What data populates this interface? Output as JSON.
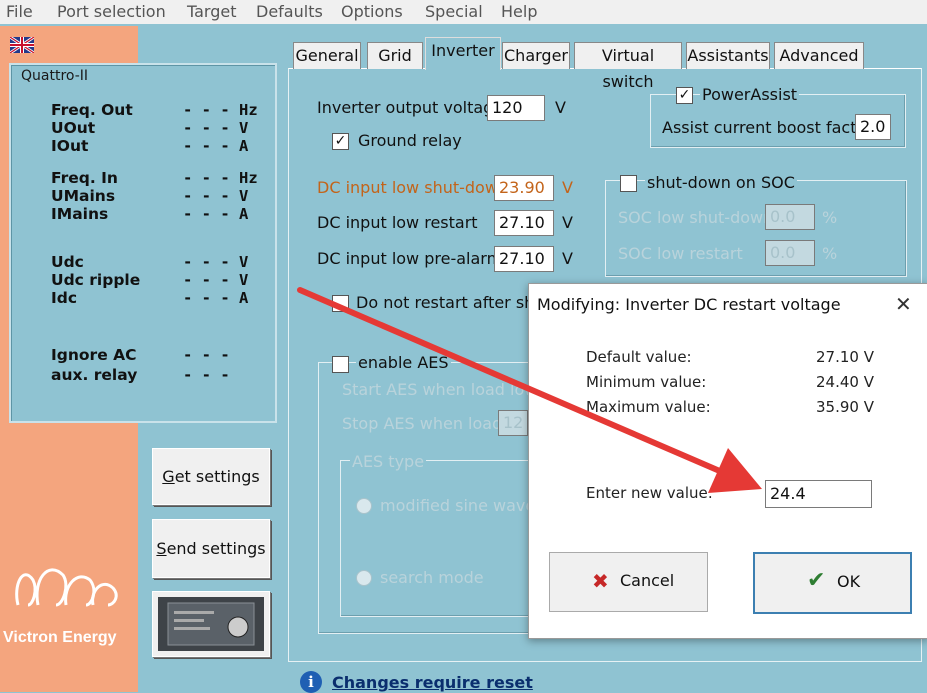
{
  "menubar": {
    "items": [
      "File",
      "Port selection",
      "Target",
      "Defaults",
      "Options",
      "Special",
      "Help"
    ]
  },
  "status": {
    "title": "Quattro-II",
    "rows": [
      {
        "label": "Freq. Out",
        "value": "- - - Hz"
      },
      {
        "label": "UOut",
        "value": "- - - V"
      },
      {
        "label": "IOut",
        "value": "- - - A"
      },
      {
        "label": "Freq. In",
        "value": "- - - Hz"
      },
      {
        "label": "UMains",
        "value": "- - - V"
      },
      {
        "label": "IMains",
        "value": "- - - A"
      },
      {
        "label": "Udc",
        "value": "- - - V"
      },
      {
        "label": "Udc ripple",
        "value": "- - - V"
      },
      {
        "label": "Idc",
        "value": "- - - A"
      },
      {
        "label": "Ignore AC",
        "value": "- - -"
      },
      {
        "label": "aux. relay",
        "value": "- - -"
      }
    ]
  },
  "left_buttons": {
    "get_settings_ul": "G",
    "get_settings_rest": "et settings",
    "send_settings_ul": "S",
    "send_settings_rest": "end settings"
  },
  "logo_text": "Victron Energy",
  "tabs": [
    "General",
    "Grid",
    "Inverter",
    "Charger",
    "Virtual switch",
    "Assistants",
    "Advanced"
  ],
  "active_tab": "Inverter",
  "inverter": {
    "output_voltage_label": "Inverter output voltage",
    "output_voltage_value": "120",
    "output_voltage_unit": "V",
    "ground_relay_label": "Ground relay",
    "ground_relay_checked": "✓",
    "shutdown_label": "DC input low shut-down",
    "shutdown_value": "23.90",
    "shutdown_unit": "V",
    "restart_label": "DC input low restart",
    "restart_value": "27.10",
    "restart_unit": "V",
    "prealarm_label": "DC input low pre-alarm",
    "prealarm_value": "27.10",
    "prealarm_unit": "V",
    "no_restart_label": "Do not restart after short",
    "power_assist_label": "PowerAssist",
    "power_assist_checked": "✓",
    "boost_label": "Assist current boost factor",
    "boost_value": "2.0",
    "soc_label": "shut-down on SOC",
    "soc_shutdown_label": "SOC low shut-down",
    "soc_shutdown_value": "0.0",
    "soc_restart_label": "SOC low restart",
    "soc_restart_value": "0.0",
    "percent": "%",
    "aes_label": "enable AES",
    "aes_start_label": "Start AES when load lowe",
    "aes_stop_label": "Stop AES when load",
    "aes_stop_value": "12",
    "aes_type_label": "AES type",
    "aes_modified_label": "modified sine wave",
    "aes_search_label": "search mode"
  },
  "dialog": {
    "title": "Modifying: Inverter DC restart voltage",
    "close": "✕",
    "default_label": "Default value:",
    "default_value": "27.10 V",
    "min_label": "Minimum value:",
    "min_value": "24.40 V",
    "max_label": "Maximum value:",
    "max_value": "35.90 V",
    "enter_label": "Enter new value:",
    "enter_value": "24.4",
    "cancel_label": "Cancel",
    "ok_label": "OK",
    "cancel_icon": "✖",
    "ok_icon": "✔"
  },
  "footer": {
    "info_icon": "i",
    "text": "Changes require reset"
  },
  "colors": {
    "accent_red": "#e53935",
    "orange_panel": "#f4a57e",
    "teal_bg": "#8fc3d2"
  }
}
